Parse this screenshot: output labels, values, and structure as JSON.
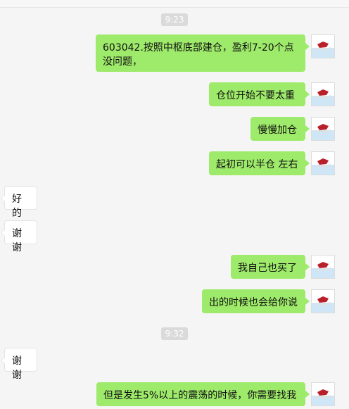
{
  "chat": {
    "timestamps": [
      "9:23",
      "9:32"
    ],
    "messages": [
      {
        "side": "right",
        "text": "603042.按照中枢底部建仓，盈利7-20个点没问题，"
      },
      {
        "side": "right",
        "text": "仓位开始不要太重"
      },
      {
        "side": "right",
        "text": "慢慢加仓"
      },
      {
        "side": "right",
        "text": "起初可以半仓 左右"
      },
      {
        "side": "left",
        "text": "好的"
      },
      {
        "side": "left",
        "text": "谢谢"
      },
      {
        "side": "right",
        "text": "我自己也买了"
      },
      {
        "side": "right",
        "text": "出的时候也会给你说"
      },
      {
        "side": "left",
        "text": "谢谢"
      },
      {
        "side": "right",
        "text": "但是发生5%以上的震荡的时候，你需要找我"
      }
    ]
  },
  "colors": {
    "sent_bubble": "#9eea6a",
    "received_bubble": "#ffffff",
    "background": "#f5f5f5",
    "timestamp_bg": "#dadada"
  },
  "icons": {
    "sender_avatar": "red-bull-logo-avatar"
  }
}
